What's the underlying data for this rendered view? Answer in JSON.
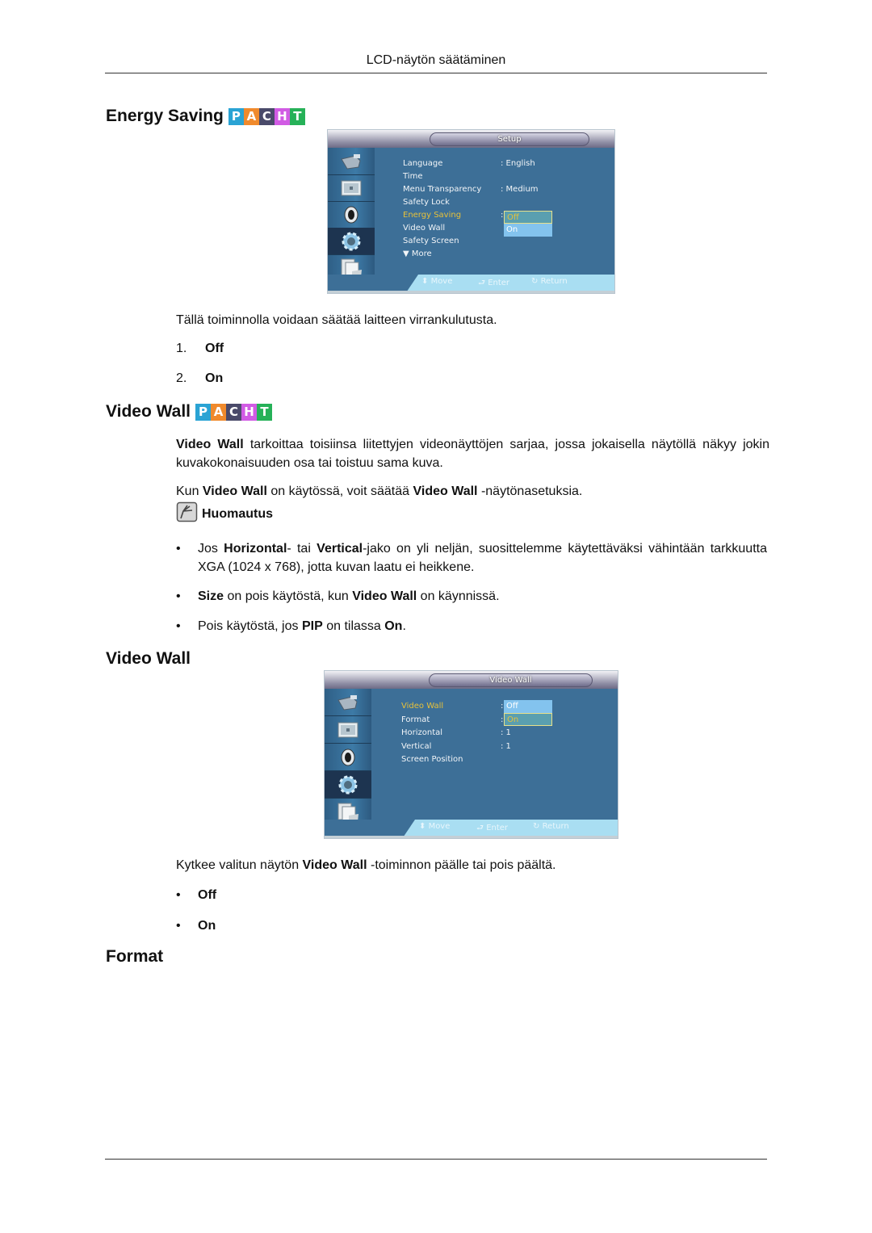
{
  "header": {
    "running_head": "LCD-näytön säätäminen"
  },
  "badge": {
    "letters": [
      "P",
      "A",
      "C",
      "H",
      "T"
    ],
    "colors": [
      "#2aa3d4",
      "#f08a2c",
      "#4a4a6a",
      "#d15be4",
      "#26b158"
    ]
  },
  "energy_saving": {
    "title": "Energy Saving",
    "osd": {
      "title": "Setup",
      "menu": [
        {
          "label": "Language",
          "value": ": English"
        },
        {
          "label": "Time",
          "value": ""
        },
        {
          "label": "Menu Transparency",
          "value": ": Medium"
        },
        {
          "label": "Safety Lock",
          "value": ""
        },
        {
          "label": "Energy Saving",
          "value": ":",
          "selected": true
        },
        {
          "label": "Video Wall",
          "value": ""
        },
        {
          "label": "Safety Screen",
          "value": ""
        },
        {
          "label": "▼ More",
          "value": ""
        }
      ],
      "dropdown": [
        {
          "label": "Off",
          "highlighted": true
        },
        {
          "label": "On",
          "highlighted": false
        }
      ],
      "footer": {
        "move": "Move",
        "enter": "Enter",
        "return": "Return"
      }
    },
    "description": "Tällä toiminnolla voidaan säätää laitteen virrankulutusta.",
    "options": [
      {
        "num": "1.",
        "label": "Off"
      },
      {
        "num": "2.",
        "label": "On"
      }
    ]
  },
  "video_wall": {
    "title": "Video Wall",
    "para1": {
      "bold": "Video Wall",
      "rest": " tarkoittaa toisiinsa liitettyjen videonäyttöjen sarjaa, jossa jokaisella näytöllä näkyy jokin kuvakokonaisuuden osa tai toistuu sama kuva."
    },
    "para2": {
      "t1": "Kun ",
      "b1": "Video Wall",
      "t2": " on käytössä, voit säätää ",
      "b2": "Video Wall",
      "t3": " -näytönasetuksia."
    },
    "note_label": "Huomautus",
    "notes": [
      {
        "t1": "Jos ",
        "b1": "Horizontal",
        "t2": "- tai ",
        "b2": "Vertical",
        "t3": "-jako on yli neljän, suosittelemme käytettäväksi vähintään tarkkuutta XGA (1024 x 768), jotta kuvan laatu ei heikkene."
      },
      {
        "b1": "Size",
        "t1": " on pois käytöstä, kun ",
        "b2": "Video Wall",
        "t2": " on käynnissä."
      },
      {
        "t1": "Pois käytöstä, jos ",
        "b1": "PIP",
        "t2": " on tilassa ",
        "b2": "On",
        "t3": "."
      }
    ]
  },
  "video_wall_sub": {
    "title": "Video Wall",
    "osd": {
      "title": "Video Wall",
      "menu": [
        {
          "label": "Video Wall",
          "value": ":",
          "selected": true
        },
        {
          "label": "Format",
          "value": ":"
        },
        {
          "label": "Horizontal",
          "value": ": 1"
        },
        {
          "label": "Vertical",
          "value": ": 1"
        },
        {
          "label": "Screen Position",
          "value": ""
        }
      ],
      "dropdown": [
        {
          "label": "Off",
          "highlighted": false
        },
        {
          "label": "On",
          "highlighted": true
        }
      ],
      "footer": {
        "move": "Move",
        "enter": "Enter",
        "return": "Return"
      }
    },
    "description": {
      "t1": "Kytkee valitun näytön ",
      "b1": "Video Wall",
      "t2": " -toiminnon päälle tai pois päältä."
    },
    "options": [
      "Off",
      "On"
    ]
  },
  "format": {
    "title": "Format"
  }
}
